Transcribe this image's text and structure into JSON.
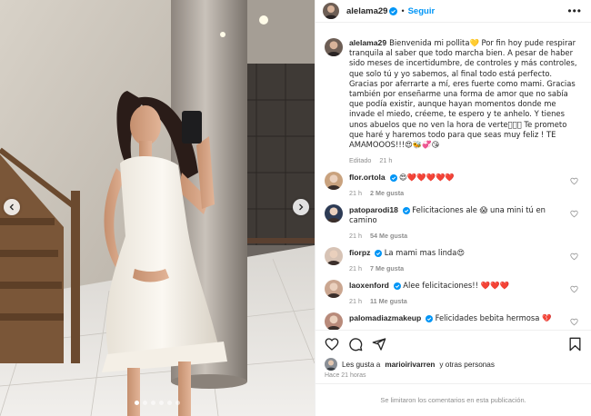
{
  "header": {
    "username": "alelama29",
    "separator": "•",
    "follow_label": "Seguir",
    "more_label": "•••"
  },
  "caption": {
    "username": "alelama29",
    "text": "Bienvenida mi pollita💛 Por fin hoy pude respirar tranquila al saber que todo marcha bien. A pesar de haber sido meses de incertidumbre, de controles y más controles, que solo tú y yo sabemos, al final todo está perfecto. Gracias por aferrarte a mí, eres fuerte como mami. Gracias también por enseñarme una forma de amor que no sabía que podía existir, aunque hayan momentos donde me invade el miedo, créeme, te espero y te anhelo. Y tienes unos abuelos que no ven la hora de verte🏻🏻🏻 Te prometo que haré y haremos todo para que seas muy feliz ! TE AMAMOOOS!!!😍🐝💞😘",
    "edited": "Editado",
    "time": "21 h"
  },
  "comments": [
    {
      "username": "flor.ortola",
      "verified": true,
      "text": "😍❤️❤️❤️❤️❤️",
      "time": "21 h",
      "likes": "2 Me gusta",
      "reply": ""
    },
    {
      "username": "patoparodi18",
      "verified": true,
      "text": "Felicitaciones ale 😱 una mini tú en camino",
      "time": "21 h",
      "likes": "54 Me gusta",
      "reply": ""
    },
    {
      "username": "fiorpz",
      "verified": true,
      "text": "La mami mas linda😍",
      "time": "21 h",
      "likes": "7 Me gusta",
      "reply": ""
    },
    {
      "username": "laoxenford",
      "verified": true,
      "text": "Alee felicitaciones!! ❤️❤️❤️",
      "time": "21 h",
      "likes": "11 Me gusta",
      "reply": ""
    },
    {
      "username": "palomadiazmakeup",
      "verified": true,
      "text": "Felicidades bebita hermosa 💔",
      "time": "",
      "likes": "",
      "reply": ""
    }
  ],
  "footer": {
    "liked_by_prefix": "Les gusta a",
    "liked_by_user": "marioirivarren",
    "liked_by_suffix": "y otras personas",
    "posted": "Hace 21 horas",
    "comments_limited": "Se limitaron los comentarios en esta publicación."
  },
  "carousel": {
    "dots": 6,
    "active_index": 0
  },
  "colors": {
    "accent": "#0095f6",
    "heart_red": "#e0245e",
    "secondary_text": "#8e8e8e"
  },
  "icons": {
    "prev": "chevron-left-icon",
    "next": "chevron-right-icon",
    "like": "heart-icon",
    "comment": "comment-icon",
    "share": "share-icon",
    "save": "bookmark-icon",
    "verified": "verified-badge-icon"
  }
}
